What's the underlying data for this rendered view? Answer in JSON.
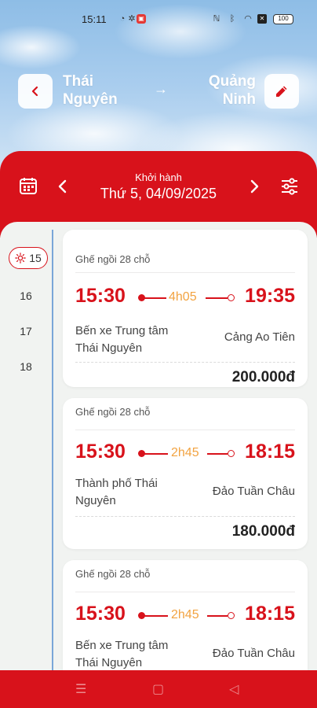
{
  "status": {
    "time": "15:11",
    "battery": "100"
  },
  "route": {
    "from_line1": "Thái",
    "from_line2": "Nguyên",
    "to_line1": "Quảng",
    "to_line2": "Ninh",
    "arrow": "→"
  },
  "date_bar": {
    "label": "Khởi hành",
    "date": "Thứ 5, 04/09/2025"
  },
  "hours": {
    "active": "15",
    "others": [
      "16",
      "17",
      "18"
    ]
  },
  "trips": [
    {
      "seat": "Ghế ngồi 28 chỗ",
      "depart": "15:30",
      "duration": "4h05",
      "arrive": "19:35",
      "from": "Bến xe Trung tâm Thái Nguyên",
      "to": "Cảng Ao Tiên",
      "price": "200.000đ"
    },
    {
      "seat": "Ghế ngồi 28 chỗ",
      "depart": "15:30",
      "duration": "2h45",
      "arrive": "18:15",
      "from": "Thành phố Thái Nguyên",
      "to": "Đảo Tuần Châu",
      "price": "180.000đ"
    },
    {
      "seat": "Ghế ngồi 28 chỗ",
      "depart": "15:30",
      "duration": "2h45",
      "arrive": "18:15",
      "from": "Bến xe Trung tâm Thái Nguyên",
      "to": "Đảo Tuần Châu",
      "price": ""
    }
  ],
  "colors": {
    "brand": "#d8121b",
    "duration": "#f2a341",
    "timeline": "#7aa6d8"
  },
  "icons": [
    "back-icon",
    "edit-icon",
    "calendar-icon",
    "prev-date-icon",
    "next-date-icon",
    "filter-icon",
    "sun-icon"
  ]
}
